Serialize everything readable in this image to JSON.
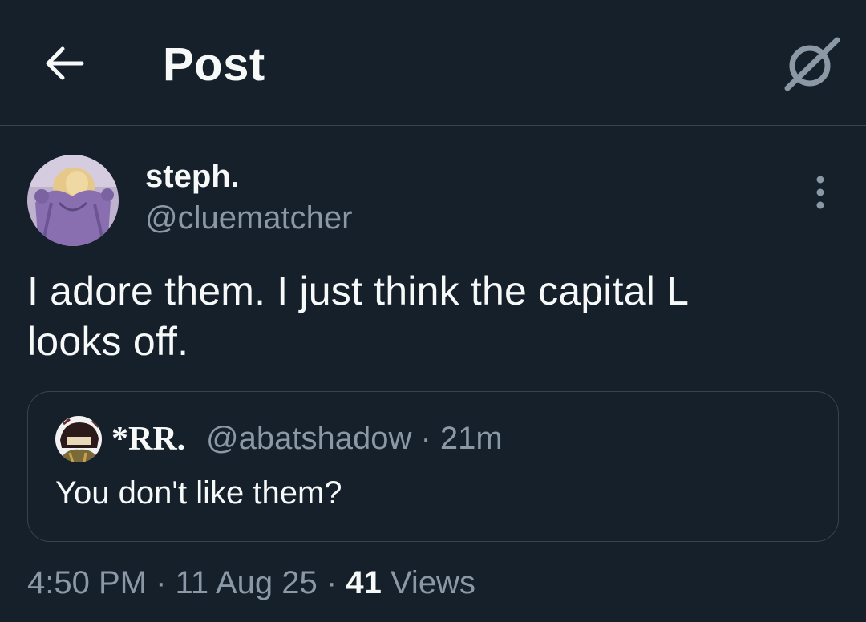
{
  "header": {
    "title": "Post",
    "back_icon": "arrow-left-icon",
    "grok_icon": "grok-icon"
  },
  "author": {
    "display_name": "steph.",
    "handle": "@cluematcher",
    "avatar_icon": "avatar-image",
    "more_icon": "more-vertical-icon"
  },
  "tweet": {
    "text_line1": "I adore them. I just think the capital L",
    "text_line2": "looks off."
  },
  "quote": {
    "display_name": "*RR.",
    "handle": "@abatshadow",
    "separator": "·",
    "time": "21m",
    "text": "You don't like them?"
  },
  "meta": {
    "time": "4:50 PM",
    "sep1": "·",
    "date": "11 Aug 25",
    "sep2": "·",
    "views_count": "41",
    "views_label": "Views"
  },
  "colors": {
    "background": "#15202b",
    "text": "#f7f9f9",
    "secondary_text": "#8b98a5",
    "border": "#38444d"
  }
}
